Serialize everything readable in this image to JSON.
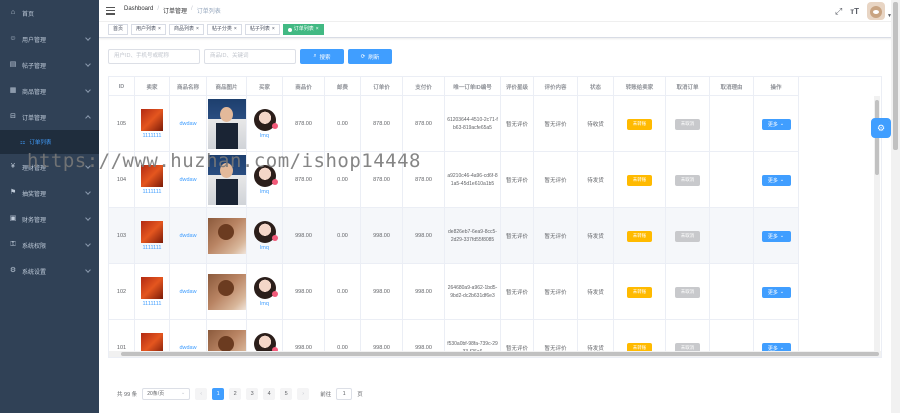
{
  "sidebar": {
    "items": [
      {
        "label": "首页",
        "icon": "dashboard-icon",
        "arrow": false
      },
      {
        "label": "用户管理",
        "icon": "user-icon",
        "arrow": true
      },
      {
        "label": "帖子管理",
        "icon": "document-icon",
        "arrow": true
      },
      {
        "label": "商品管理",
        "icon": "goods-icon",
        "arrow": true
      },
      {
        "label": "订单管理",
        "icon": "cart-icon",
        "arrow": true,
        "open": true
      },
      {
        "label": "理财管理",
        "icon": "money-icon",
        "arrow": true
      },
      {
        "label": "抽奖管理",
        "icon": "gift-icon",
        "arrow": true
      },
      {
        "label": "财务管理",
        "icon": "finance-icon",
        "arrow": true
      },
      {
        "label": "系统权限",
        "icon": "lock-icon",
        "arrow": true
      },
      {
        "label": "系统设置",
        "icon": "gear-icon",
        "arrow": true
      }
    ],
    "sub_item": "订单列表"
  },
  "breadcrumb": {
    "home": "Dashboard",
    "section": "订单管理",
    "current": "订单列表",
    "sep": "/"
  },
  "tags": [
    {
      "label": "首页",
      "active": false,
      "closable": false
    },
    {
      "label": "用户列表",
      "active": false,
      "closable": true
    },
    {
      "label": "商品列表",
      "active": false,
      "closable": true
    },
    {
      "label": "帖子分类",
      "active": false,
      "closable": true
    },
    {
      "label": "帖子列表",
      "active": false,
      "closable": true
    },
    {
      "label": "订单列表",
      "active": true,
      "closable": true
    }
  ],
  "search": {
    "user_placeholder": "用户ID、手机号或昵称",
    "goods_placeholder": "商品ID、关键词",
    "search_label": "搜索",
    "refresh_label": "刷新"
  },
  "table": {
    "columns": [
      "ID",
      "卖家",
      "商品名称",
      "商品图片",
      "买家",
      "商品价",
      "邮费",
      "订单价",
      "支付价",
      "唯一订单ID编号",
      "评价星级",
      "评价内容",
      "状态",
      "转账给卖家",
      "取消订单",
      "取消理由",
      "操作"
    ],
    "rows": [
      {
        "id": "105",
        "seller": "1111111",
        "goods": "dwdaw",
        "img": "suit",
        "buyer": "lmq",
        "price": "878.00",
        "postage": "0.00",
        "order_price": "878.00",
        "pay_price": "878.00",
        "hash": "61203644-4510-2c71-fb63-819acfe65a5",
        "star": "暂无评价",
        "comment": "暂无评价",
        "status": "待收货",
        "transfer": "未转账",
        "cancel": "未取消",
        "reason": "",
        "more": "更多"
      },
      {
        "id": "104",
        "seller": "1111111",
        "goods": "dwdaw",
        "img": "suit",
        "buyer": "lmq",
        "price": "878.00",
        "postage": "0.00",
        "order_price": "878.00",
        "pay_price": "878.00",
        "hash": "a9210c46-4a96-cd6f-81a5-45d1e610a1b5",
        "star": "暂无评价",
        "comment": "暂无评价",
        "status": "待发货",
        "transfer": "未转账",
        "cancel": "未取消",
        "reason": "",
        "more": "更多"
      },
      {
        "id": "103",
        "seller": "1111111",
        "goods": "dwdaw",
        "img": "dog",
        "buyer": "lmq",
        "price": "998.00",
        "postage": "0.00",
        "order_price": "998.00",
        "pay_price": "998.00",
        "hash": "de826eb7-6ea9-8cc5-2d29-337fd55f8085",
        "star": "暂无评价",
        "comment": "暂无评价",
        "status": "待发货",
        "transfer": "未转账",
        "cancel": "未取消",
        "reason": "",
        "more": "更多"
      },
      {
        "id": "102",
        "seller": "1111111",
        "goods": "dwdaw",
        "img": "dog",
        "buyer": "lmq",
        "price": "998.00",
        "postage": "0.00",
        "order_price": "998.00",
        "pay_price": "998.00",
        "hash": "264680a9-a962-1bd5-9bd2-dc2b631df6e3",
        "star": "暂无评价",
        "comment": "暂无评价",
        "status": "待发货",
        "transfer": "未转账",
        "cancel": "未取消",
        "reason": "",
        "more": "更多"
      },
      {
        "id": "101",
        "seller": "1111111",
        "goods": "dwdaw",
        "img": "dog",
        "buyer": "lmq",
        "price": "998.00",
        "postage": "0.00",
        "order_price": "998.00",
        "pay_price": "998.00",
        "hash": "f530a0bf-98fa-739c-2933-f26a6",
        "star": "暂无评价",
        "comment": "暂无评价",
        "status": "待发货",
        "transfer": "未转账",
        "cancel": "未取消",
        "reason": "",
        "more": "更多"
      }
    ]
  },
  "pagination": {
    "total": "共 99 条",
    "page_size": "20条/页",
    "pages": [
      "1",
      "2",
      "3",
      "4",
      "5"
    ],
    "current": "1",
    "goto": "前往",
    "goto_value": "1",
    "page_suffix": "页",
    "prev": "‹",
    "next": "›"
  },
  "watermark": "https://www.huzhan.com/ishop14448"
}
